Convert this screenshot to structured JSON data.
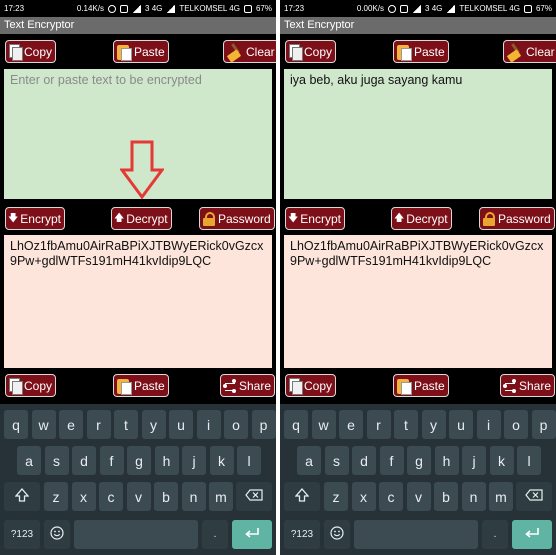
{
  "screens": [
    {
      "status": {
        "time": "17:23",
        "speed": "0.14K/s",
        "network": "3 4G",
        "carrier": "TELKOMSEL 4G",
        "battery": "67%"
      },
      "title": "Text Encryptor",
      "top_buttons": {
        "copy": "Copy",
        "paste": "Paste",
        "clear": "Clear"
      },
      "input": {
        "placeholder": "Enter or paste text to be encrypted",
        "value": ""
      },
      "mid_buttons": {
        "encrypt": "Encrypt",
        "decrypt": "Decrypt",
        "password": "Password"
      },
      "output": "LhOz1fbAmu0AirRaBPiXJTBWyERick0vGzcx9Pw+gdlWTFs191mH41kvIdip9LQC",
      "bottom_buttons": {
        "copy": "Copy",
        "paste": "Paste",
        "share": "Share"
      }
    },
    {
      "status": {
        "time": "17:23",
        "speed": "0.00K/s",
        "network": "3 4G",
        "carrier": "TELKOMSEL 4G",
        "battery": "67%"
      },
      "title": "Text Encryptor",
      "top_buttons": {
        "copy": "Copy",
        "paste": "Paste",
        "clear": "Clear"
      },
      "input": {
        "placeholder": "",
        "value": "iya beb, aku juga sayang kamu"
      },
      "mid_buttons": {
        "encrypt": "Encrypt",
        "decrypt": "Decrypt",
        "password": "Password"
      },
      "output": "LhOz1fbAmu0AirRaBPiXJTBWyERick0vGzcx9Pw+gdlWTFs191mH41kvIdip9LQC",
      "bottom_buttons": {
        "copy": "Copy",
        "paste": "Paste",
        "share": "Share"
      }
    }
  ],
  "keyboard": {
    "row1": [
      "q",
      "w",
      "e",
      "r",
      "t",
      "y",
      "u",
      "i",
      "o",
      "p"
    ],
    "row2": [
      "a",
      "s",
      "d",
      "f",
      "g",
      "h",
      "j",
      "k",
      "l"
    ],
    "row3": [
      "z",
      "x",
      "c",
      "v",
      "b",
      "n",
      "m"
    ],
    "symbols_key": "?123",
    "period_key": ".",
    "shift_icon": "shift-arrow-icon",
    "backspace_icon": "backspace-icon",
    "emoji_icon": "emoji-icon",
    "enter_icon": "enter-return-icon"
  },
  "annotation": {
    "icon": "red-down-arrow-icon",
    "color": "#e53935"
  },
  "colors": {
    "button_bg": "#7d0f18",
    "input_bg": "#cfe8cc",
    "output_bg": "#fde5dc",
    "titlebar": "#6b6b6b",
    "keyboard_bg": "#263238",
    "enter_key": "#5fb4a4"
  }
}
